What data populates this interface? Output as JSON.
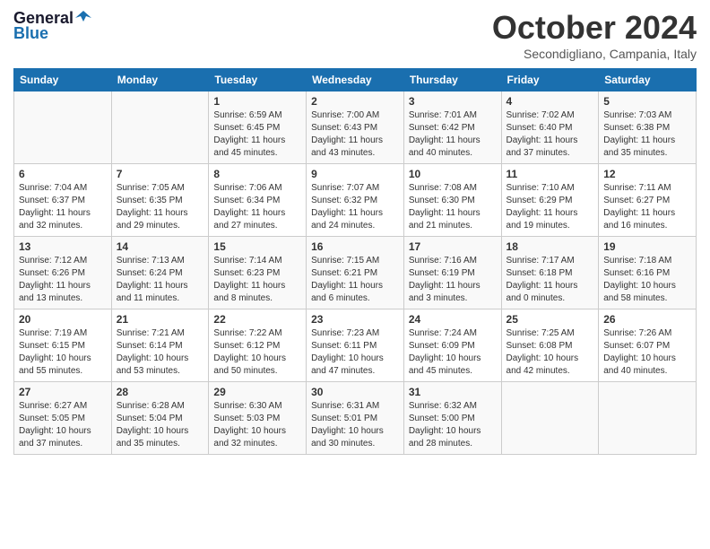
{
  "header": {
    "logo_general": "General",
    "logo_blue": "Blue",
    "month_title": "October 2024",
    "location": "Secondigliano, Campania, Italy"
  },
  "weekdays": [
    "Sunday",
    "Monday",
    "Tuesday",
    "Wednesday",
    "Thursday",
    "Friday",
    "Saturday"
  ],
  "weeks": [
    [
      {
        "day": "",
        "sunrise": "",
        "sunset": "",
        "daylight": ""
      },
      {
        "day": "",
        "sunrise": "",
        "sunset": "",
        "daylight": ""
      },
      {
        "day": "1",
        "sunrise": "Sunrise: 6:59 AM",
        "sunset": "Sunset: 6:45 PM",
        "daylight": "Daylight: 11 hours and 45 minutes."
      },
      {
        "day": "2",
        "sunrise": "Sunrise: 7:00 AM",
        "sunset": "Sunset: 6:43 PM",
        "daylight": "Daylight: 11 hours and 43 minutes."
      },
      {
        "day": "3",
        "sunrise": "Sunrise: 7:01 AM",
        "sunset": "Sunset: 6:42 PM",
        "daylight": "Daylight: 11 hours and 40 minutes."
      },
      {
        "day": "4",
        "sunrise": "Sunrise: 7:02 AM",
        "sunset": "Sunset: 6:40 PM",
        "daylight": "Daylight: 11 hours and 37 minutes."
      },
      {
        "day": "5",
        "sunrise": "Sunrise: 7:03 AM",
        "sunset": "Sunset: 6:38 PM",
        "daylight": "Daylight: 11 hours and 35 minutes."
      }
    ],
    [
      {
        "day": "6",
        "sunrise": "Sunrise: 7:04 AM",
        "sunset": "Sunset: 6:37 PM",
        "daylight": "Daylight: 11 hours and 32 minutes."
      },
      {
        "day": "7",
        "sunrise": "Sunrise: 7:05 AM",
        "sunset": "Sunset: 6:35 PM",
        "daylight": "Daylight: 11 hours and 29 minutes."
      },
      {
        "day": "8",
        "sunrise": "Sunrise: 7:06 AM",
        "sunset": "Sunset: 6:34 PM",
        "daylight": "Daylight: 11 hours and 27 minutes."
      },
      {
        "day": "9",
        "sunrise": "Sunrise: 7:07 AM",
        "sunset": "Sunset: 6:32 PM",
        "daylight": "Daylight: 11 hours and 24 minutes."
      },
      {
        "day": "10",
        "sunrise": "Sunrise: 7:08 AM",
        "sunset": "Sunset: 6:30 PM",
        "daylight": "Daylight: 11 hours and 21 minutes."
      },
      {
        "day": "11",
        "sunrise": "Sunrise: 7:10 AM",
        "sunset": "Sunset: 6:29 PM",
        "daylight": "Daylight: 11 hours and 19 minutes."
      },
      {
        "day": "12",
        "sunrise": "Sunrise: 7:11 AM",
        "sunset": "Sunset: 6:27 PM",
        "daylight": "Daylight: 11 hours and 16 minutes."
      }
    ],
    [
      {
        "day": "13",
        "sunrise": "Sunrise: 7:12 AM",
        "sunset": "Sunset: 6:26 PM",
        "daylight": "Daylight: 11 hours and 13 minutes."
      },
      {
        "day": "14",
        "sunrise": "Sunrise: 7:13 AM",
        "sunset": "Sunset: 6:24 PM",
        "daylight": "Daylight: 11 hours and 11 minutes."
      },
      {
        "day": "15",
        "sunrise": "Sunrise: 7:14 AM",
        "sunset": "Sunset: 6:23 PM",
        "daylight": "Daylight: 11 hours and 8 minutes."
      },
      {
        "day": "16",
        "sunrise": "Sunrise: 7:15 AM",
        "sunset": "Sunset: 6:21 PM",
        "daylight": "Daylight: 11 hours and 6 minutes."
      },
      {
        "day": "17",
        "sunrise": "Sunrise: 7:16 AM",
        "sunset": "Sunset: 6:19 PM",
        "daylight": "Daylight: 11 hours and 3 minutes."
      },
      {
        "day": "18",
        "sunrise": "Sunrise: 7:17 AM",
        "sunset": "Sunset: 6:18 PM",
        "daylight": "Daylight: 11 hours and 0 minutes."
      },
      {
        "day": "19",
        "sunrise": "Sunrise: 7:18 AM",
        "sunset": "Sunset: 6:16 PM",
        "daylight": "Daylight: 10 hours and 58 minutes."
      }
    ],
    [
      {
        "day": "20",
        "sunrise": "Sunrise: 7:19 AM",
        "sunset": "Sunset: 6:15 PM",
        "daylight": "Daylight: 10 hours and 55 minutes."
      },
      {
        "day": "21",
        "sunrise": "Sunrise: 7:21 AM",
        "sunset": "Sunset: 6:14 PM",
        "daylight": "Daylight: 10 hours and 53 minutes."
      },
      {
        "day": "22",
        "sunrise": "Sunrise: 7:22 AM",
        "sunset": "Sunset: 6:12 PM",
        "daylight": "Daylight: 10 hours and 50 minutes."
      },
      {
        "day": "23",
        "sunrise": "Sunrise: 7:23 AM",
        "sunset": "Sunset: 6:11 PM",
        "daylight": "Daylight: 10 hours and 47 minutes."
      },
      {
        "day": "24",
        "sunrise": "Sunrise: 7:24 AM",
        "sunset": "Sunset: 6:09 PM",
        "daylight": "Daylight: 10 hours and 45 minutes."
      },
      {
        "day": "25",
        "sunrise": "Sunrise: 7:25 AM",
        "sunset": "Sunset: 6:08 PM",
        "daylight": "Daylight: 10 hours and 42 minutes."
      },
      {
        "day": "26",
        "sunrise": "Sunrise: 7:26 AM",
        "sunset": "Sunset: 6:07 PM",
        "daylight": "Daylight: 10 hours and 40 minutes."
      }
    ],
    [
      {
        "day": "27",
        "sunrise": "Sunrise: 6:27 AM",
        "sunset": "Sunset: 5:05 PM",
        "daylight": "Daylight: 10 hours and 37 minutes."
      },
      {
        "day": "28",
        "sunrise": "Sunrise: 6:28 AM",
        "sunset": "Sunset: 5:04 PM",
        "daylight": "Daylight: 10 hours and 35 minutes."
      },
      {
        "day": "29",
        "sunrise": "Sunrise: 6:30 AM",
        "sunset": "Sunset: 5:03 PM",
        "daylight": "Daylight: 10 hours and 32 minutes."
      },
      {
        "day": "30",
        "sunrise": "Sunrise: 6:31 AM",
        "sunset": "Sunset: 5:01 PM",
        "daylight": "Daylight: 10 hours and 30 minutes."
      },
      {
        "day": "31",
        "sunrise": "Sunrise: 6:32 AM",
        "sunset": "Sunset: 5:00 PM",
        "daylight": "Daylight: 10 hours and 28 minutes."
      },
      {
        "day": "",
        "sunrise": "",
        "sunset": "",
        "daylight": ""
      },
      {
        "day": "",
        "sunrise": "",
        "sunset": "",
        "daylight": ""
      }
    ]
  ]
}
